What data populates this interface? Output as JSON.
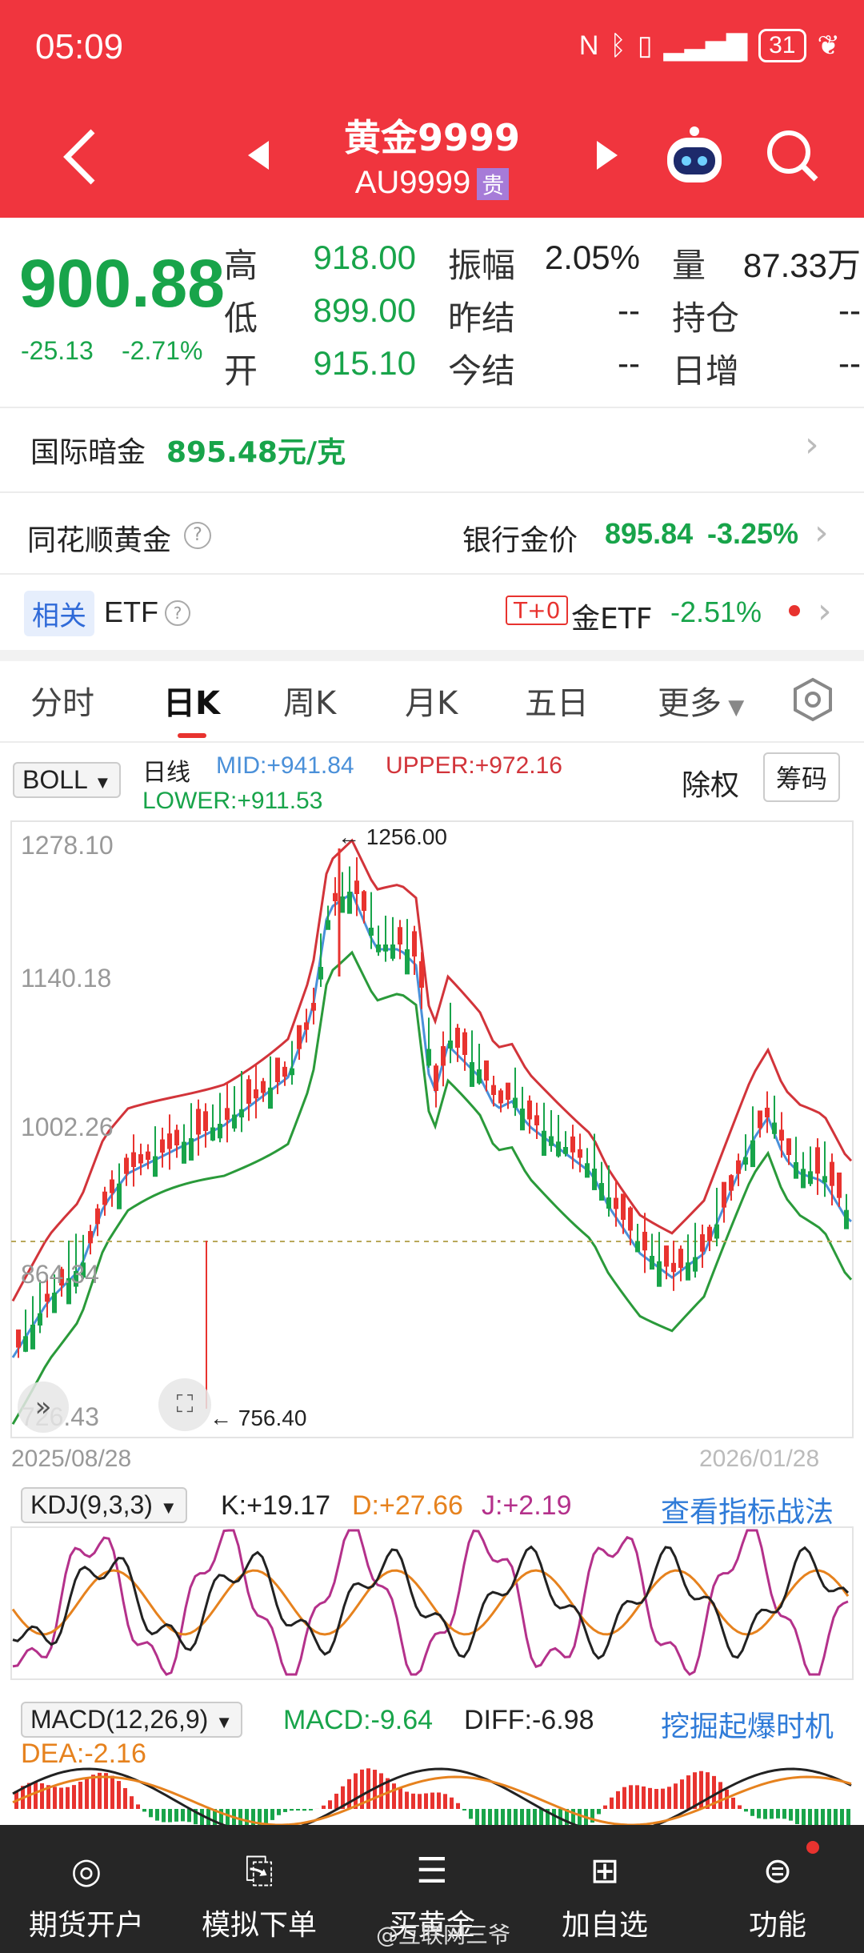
{
  "status": {
    "time": "05:09",
    "battery": "31"
  },
  "header": {
    "title": "黄金9999",
    "code": "AU9999",
    "badge": "贵"
  },
  "quote": {
    "price": "900.88",
    "change": "-25.13",
    "change_pct": "-2.71%",
    "labels": {
      "high": "高",
      "low": "低",
      "open": "开",
      "amplitude": "振幅",
      "prev_settle": "昨结",
      "settle": "今结",
      "volume": "量",
      "position": "持仓",
      "daily_inc": "日增"
    },
    "values": {
      "high": "918.00",
      "low": "899.00",
      "open": "915.10",
      "amplitude": "2.05%",
      "prev_settle": "--",
      "settle": "--",
      "volume": "87.33万",
      "position": "--",
      "daily_inc": "--"
    }
  },
  "intl": {
    "label": "国际暗金",
    "value": "895.48元/克"
  },
  "ths": {
    "label": "同花顺黄金",
    "bank_label": "银行金价",
    "bank_price": "895.84",
    "bank_pct": "-3.25%"
  },
  "etf": {
    "tag": "相关",
    "label": "ETF",
    "t0": "T+0",
    "name": "金ETF",
    "pct": "-2.51%"
  },
  "tabs": [
    "分时",
    "日K",
    "周K",
    "月K",
    "五日",
    "更多"
  ],
  "indicator": {
    "name": "BOLL",
    "period": "日线",
    "mid": "MID:+941.84",
    "upper": "UPPER:+972.16",
    "lower": "LOWER:+911.53",
    "fq": "除权",
    "chips": "筹码"
  },
  "chart": {
    "y_labels": [
      "1278.10",
      "1140.18",
      "1002.26",
      "864.34",
      "726.43"
    ],
    "high_mark": "1256.00",
    "low_mark": "756.40",
    "date": "2025/08/28",
    "right_date": "2026/01/28"
  },
  "kdj": {
    "name": "KDJ(9,3,3)",
    "k": "K:+19.17",
    "d": "D:+27.66",
    "j": "J:+2.19",
    "link": "查看指标战法"
  },
  "macd": {
    "name": "MACD(12,26,9)",
    "macd": "MACD:-9.64",
    "diff": "DIFF:-6.98",
    "dea": "DEA:-2.16",
    "link": "挖掘起爆时机"
  },
  "nav": [
    "期货开户",
    "模拟下单",
    "买黄金",
    "加自选",
    "功能"
  ],
  "watermark": "@互联网三爷",
  "colors": {
    "header": "#f0353e",
    "up": "#e8332f",
    "down": "#18a44a",
    "mid": "#4a90d9"
  }
}
